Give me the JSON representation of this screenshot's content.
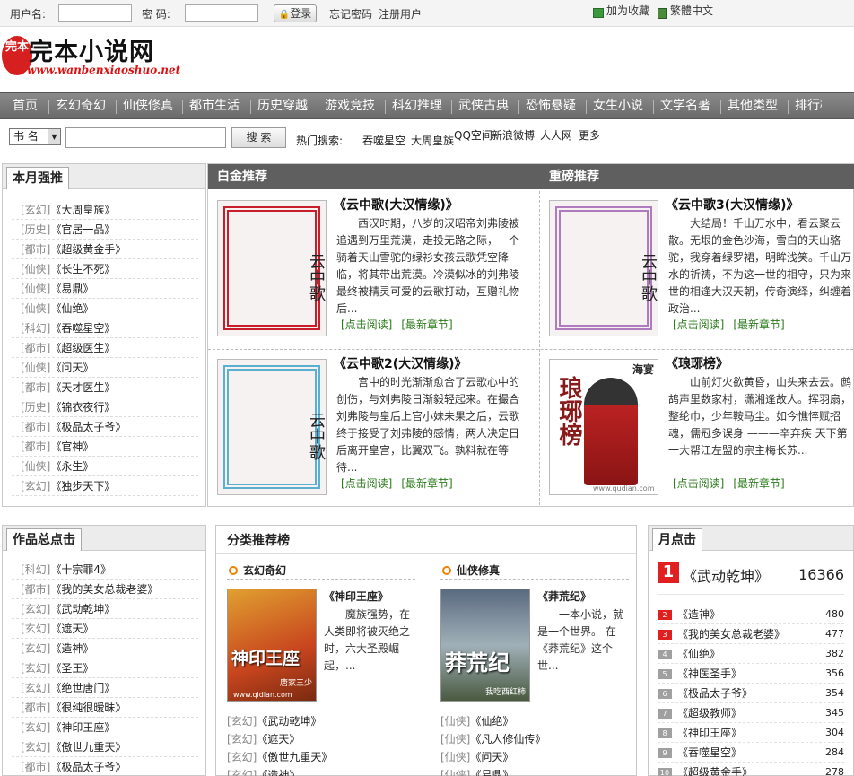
{
  "topbar": {
    "username_label": "用户名:",
    "password_label": "密  码:",
    "login_button": "登录",
    "forgot_password": "忘记密码",
    "register": "注册用户",
    "favorite": "加为收藏",
    "traditional": "繁體中文"
  },
  "logo": {
    "seal": "完本",
    "name": "完本小说网",
    "url": "www.wanbenxiaoshuo.net"
  },
  "nav": [
    "首页",
    "玄幻奇幻",
    "仙侠修真",
    "都市生活",
    "历史穿越",
    "游戏竞技",
    "科幻推理",
    "武侠古典",
    "恐怖悬疑",
    "女生小说",
    "文学名著",
    "其他类型",
    "排行榜"
  ],
  "search": {
    "select_value": "书 名",
    "button": "搜 索",
    "hot_label": "热门搜索:",
    "hot_items": [
      "吞噬星空",
      "大周皇族",
      "QQ空间",
      "新浪微博",
      "人人网",
      "更多"
    ]
  },
  "monthly": {
    "title": "本月强推",
    "items": [
      {
        "cat": "[玄幻]",
        "book": "《大周皇族》"
      },
      {
        "cat": "[历史]",
        "book": "《官居一品》"
      },
      {
        "cat": "[都市]",
        "book": "《超级黄金手》"
      },
      {
        "cat": "[仙侠]",
        "book": "《长生不死》"
      },
      {
        "cat": "[仙侠]",
        "book": "《易鼎》"
      },
      {
        "cat": "[仙侠]",
        "book": "《仙绝》"
      },
      {
        "cat": "[科幻]",
        "book": "《吞噬星空》"
      },
      {
        "cat": "[都市]",
        "book": "《超级医生》"
      },
      {
        "cat": "[仙侠]",
        "book": "《问天》"
      },
      {
        "cat": "[都市]",
        "book": "《天才医生》"
      },
      {
        "cat": "[历史]",
        "book": "《锦衣夜行》"
      },
      {
        "cat": "[都市]",
        "book": "《极品太子爷》"
      },
      {
        "cat": "[都市]",
        "book": "《官神》"
      },
      {
        "cat": "[仙侠]",
        "book": "《永生》"
      },
      {
        "cat": "[玄幻]",
        "book": "《独步天下》"
      }
    ]
  },
  "platinum": {
    "title": "白金推荐",
    "heavy_title": "重磅推荐",
    "read_link": "[点击阅读]",
    "latest_link": "[最新章节]",
    "books": [
      {
        "title": "《云中歌(大汉情缘)》",
        "cover_text": "云中歌",
        "color": "#c81e2c",
        "desc": "西汉时期，八岁的汉昭帝刘弗陵被追遇到万里荒漠，走投无路之际，一个骑着天山雪驼的绿衫女孩云歌凭空降临，将其带出荒漠。冷漠似冰的刘弗陵最终被精灵可爱的云歌打动，互赠礼物后..."
      },
      {
        "title": "《云中歌3(大汉情缘)》",
        "cover_text": "云中歌",
        "color": "#b07abf",
        "desc": "大结局！千山万水中，看云聚云散。无垠的金色沙海，雪白的天山骆驼，我穿着绿罗裙，明眸浅笑。千山万水的祈祷，不为这一世的相守，只为来世的相逢大汉天朝，传奇演绎，纠缠着政治..."
      },
      {
        "title": "《云中歌2(大汉情缘)》",
        "cover_text": "云中歌",
        "color": "#5ab0d0",
        "desc": "宫中的时光渐渐愈合了云歌心中的创伤，与刘弗陵日渐毅轻起来。在撮合刘弗陵与皇后上官小妹未果之后，云歌终于接受了刘弗陵的感情，两人决定日后离开皇宫，比翼双飞。孰料就在等待..."
      },
      {
        "title": "《琅琊榜》",
        "cover_text": "琅琊榜",
        "color": "#8a1a1a",
        "cover_author": "海宴",
        "cover_site": "www.qudian.com",
        "desc": "山前灯火欲黄昏，山头来去云。鹧鸪声里数家村，潇湘逢故人。挥羽扇，整纶巾，少年鞍马尘。如今憔悴赋招魂，儒冠多误身 ———辛弃疾 天下第一大帮江左盟的宗主梅长苏..."
      }
    ]
  },
  "total": {
    "title": "作品总点击",
    "items": [
      {
        "cat": "[科幻]",
        "book": "《十宗罪4》"
      },
      {
        "cat": "[都市]",
        "book": "《我的美女总裁老婆》"
      },
      {
        "cat": "[玄幻]",
        "book": "《武动乾坤》"
      },
      {
        "cat": "[玄幻]",
        "book": "《遮天》"
      },
      {
        "cat": "[玄幻]",
        "book": "《造神》"
      },
      {
        "cat": "[玄幻]",
        "book": "《圣王》"
      },
      {
        "cat": "[玄幻]",
        "book": "《绝世唐门》"
      },
      {
        "cat": "[都市]",
        "book": "《很纯很暧昧》"
      },
      {
        "cat": "[玄幻]",
        "book": "《神印王座》"
      },
      {
        "cat": "[玄幻]",
        "book": "《傲世九重天》"
      },
      {
        "cat": "[都市]",
        "book": "《极品太子爷》"
      }
    ]
  },
  "category": {
    "title": "分类推荐榜",
    "sections": [
      {
        "name": "玄幻奇幻",
        "book": "《神印王座》",
        "cover_text": "神印王座",
        "cover_author": "唐家三少",
        "cover_site": "www.qidian.com",
        "desc": "魔族强势，在人类即将被灭绝之时，六大圣殿崛起，...",
        "list": [
          {
            "cat": "[玄幻]",
            "book": "《武动乾坤》"
          },
          {
            "cat": "[玄幻]",
            "book": "《遮天》"
          },
          {
            "cat": "[玄幻]",
            "book": "《傲世九重天》"
          },
          {
            "cat": "[玄幻]",
            "book": "《造神》"
          }
        ]
      },
      {
        "name": "仙侠修真",
        "book": "《莽荒纪》",
        "cover_text": "莽荒纪",
        "cover_author": "我吃西红柿",
        "desc": "一本小说，就是一个世界。 在《莽荒纪》这个世...",
        "list": [
          {
            "cat": "[仙侠]",
            "book": "《仙绝》"
          },
          {
            "cat": "[仙侠]",
            "book": "《凡人修仙传》"
          },
          {
            "cat": "[仙侠]",
            "book": "《问天》"
          },
          {
            "cat": "[仙侠]",
            "book": "《易鼎》"
          }
        ]
      }
    ]
  },
  "monthly_click": {
    "title": "月点击",
    "top": {
      "rank": "1",
      "book": "《武动乾坤》",
      "count": "16366"
    },
    "items": [
      {
        "rank": "2",
        "book": "《造神》",
        "count": "480",
        "color": "#e02020"
      },
      {
        "rank": "3",
        "book": "《我的美女总裁老婆》",
        "count": "477",
        "color": "#e02020"
      },
      {
        "rank": "4",
        "book": "《仙绝》",
        "count": "382",
        "color": "#a0a0a0"
      },
      {
        "rank": "5",
        "book": "《神医圣手》",
        "count": "356",
        "color": "#a0a0a0"
      },
      {
        "rank": "6",
        "book": "《极品太子爷》",
        "count": "354",
        "color": "#a0a0a0"
      },
      {
        "rank": "7",
        "book": "《超级教师》",
        "count": "345",
        "color": "#a0a0a0"
      },
      {
        "rank": "8",
        "book": "《神印王座》",
        "count": "304",
        "color": "#a0a0a0"
      },
      {
        "rank": "9",
        "book": "《吞噬星空》",
        "count": "284",
        "color": "#a0a0a0"
      },
      {
        "rank": "10",
        "book": "《超级黄金手》",
        "count": "278",
        "color": "#a0a0a0"
      }
    ]
  }
}
